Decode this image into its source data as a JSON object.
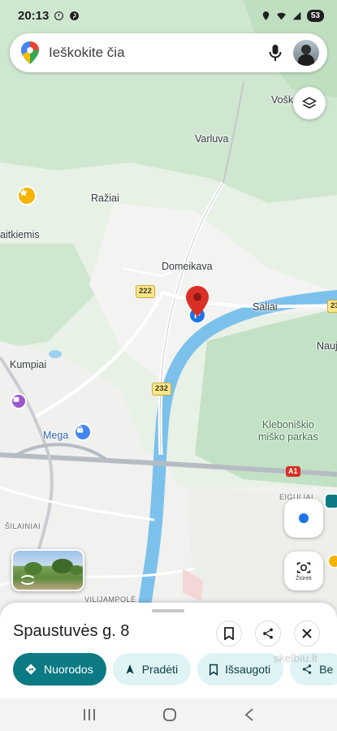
{
  "status_bar": {
    "time": "20:13",
    "battery": "53"
  },
  "search": {
    "placeholder": "Ieškokite čia"
  },
  "map": {
    "labels": {
      "vosk": "Vošk",
      "varluva": "Varluva",
      "raziai": "Ražiai",
      "aitkiemis": "aitkiemis",
      "domeikava": "Domeikava",
      "saliai": "Saliai",
      "kumpiai": "Kumpiai",
      "mega": "Mega",
      "nauj": "Nauj",
      "klebonisko": "Kleboniškio\nmiško parkas",
      "eiguliai": "EIGULIAI",
      "silainiai": "ŠILAINIAI",
      "vilijampole": "VILIJAMPOLĖ"
    },
    "shields": {
      "r222": "222",
      "r232": "232",
      "a1": "A1",
      "edge": "23"
    },
    "lens_caption": "Žiūrėti"
  },
  "place": {
    "title": "Spaustuvės g. 8",
    "actions": {
      "directions": "Nuorodos",
      "start": "Pradėti",
      "saved": "Išsaugoti",
      "share": "Be"
    }
  },
  "watermark": "skelbiu.lt",
  "colors": {
    "accent": "#0b7a84",
    "chip_bg": "#dff3f4",
    "river": "#6fb9e8",
    "pin": "#d93025"
  }
}
